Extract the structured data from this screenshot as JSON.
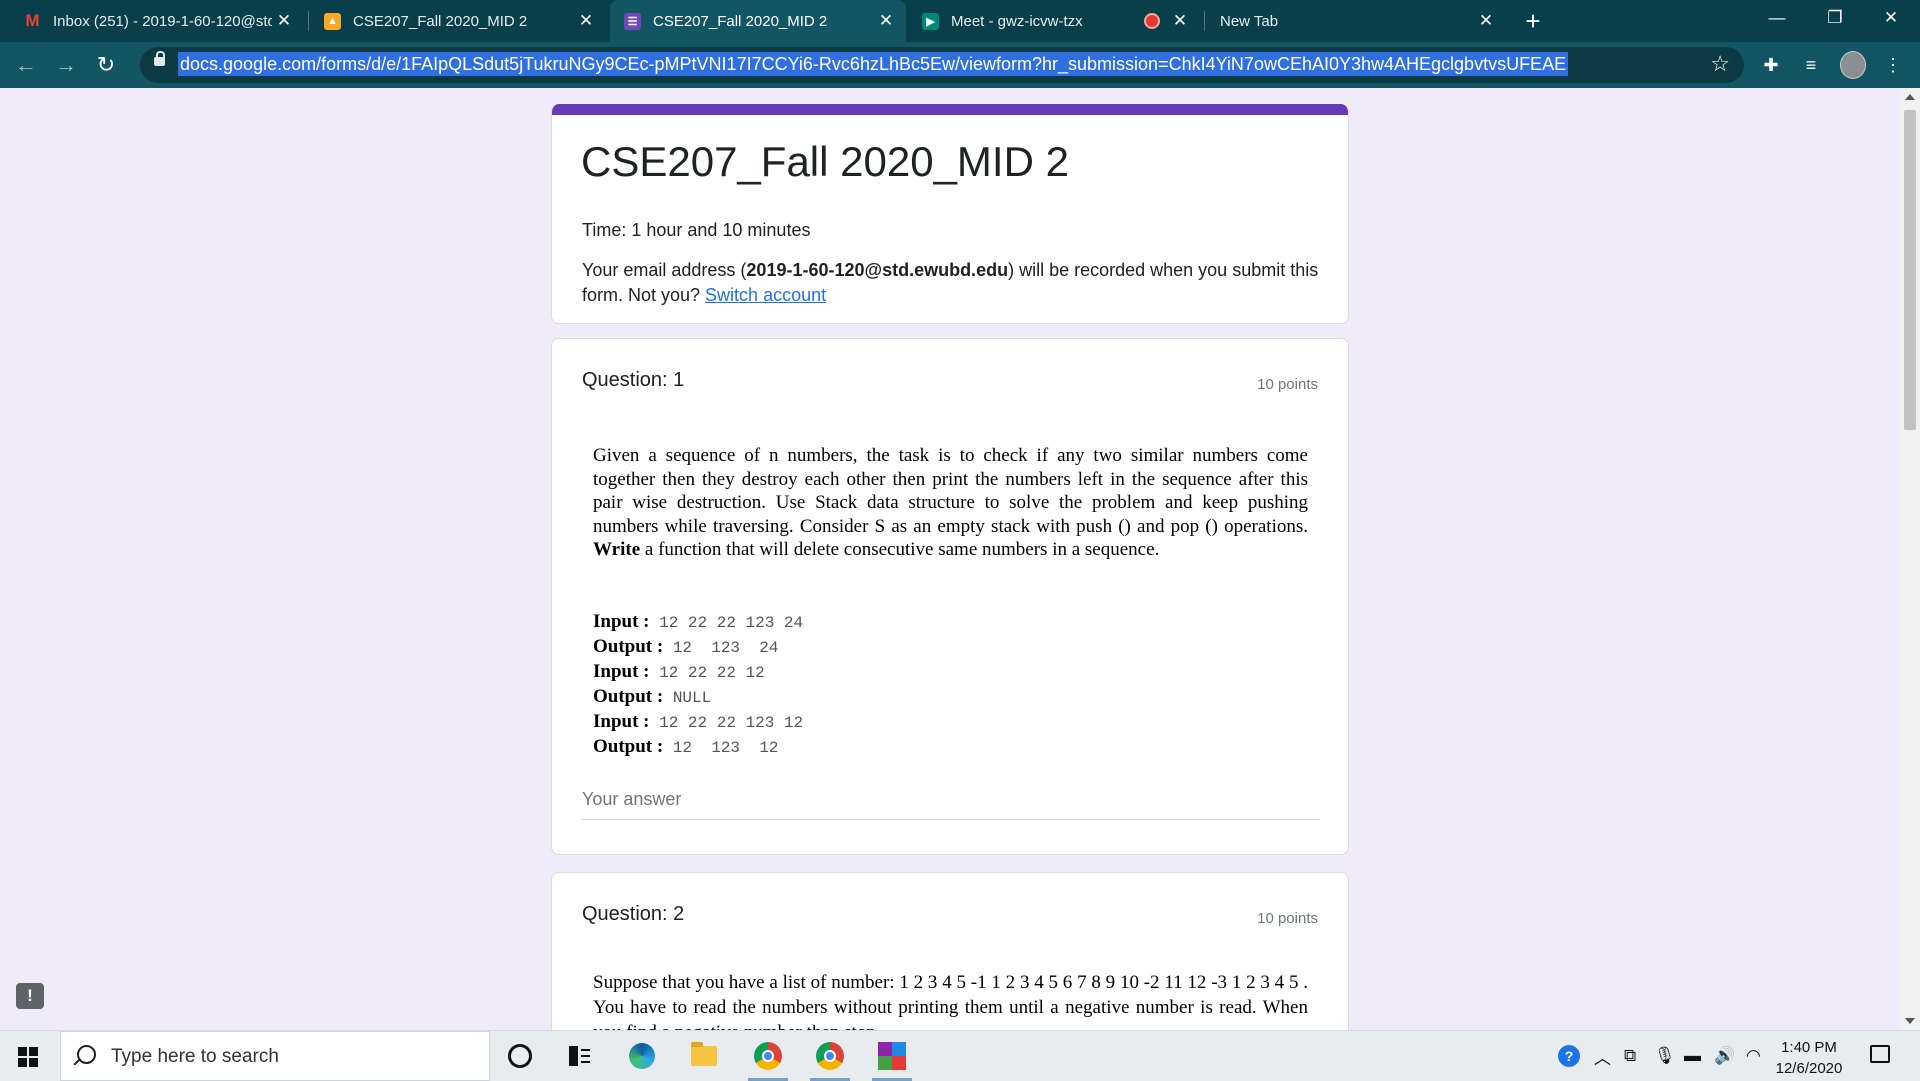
{
  "browser": {
    "tabs": [
      {
        "title": "Inbox (251) - 2019-1-60-120@std",
        "icon": "gmail-icon",
        "close": "✕"
      },
      {
        "title": "CSE207_Fall 2020_MID 2",
        "icon": "classroom-icon",
        "close": "✕"
      },
      {
        "title": "CSE207_Fall 2020_MID 2",
        "icon": "forms-icon",
        "close": "✕",
        "active": true
      },
      {
        "title": "Meet - gwz-icvw-tzx",
        "icon": "meet-icon",
        "close": "✕",
        "recording": true
      },
      {
        "title": "New Tab",
        "close": "✕"
      }
    ],
    "new_tab": "+",
    "window_controls": {
      "minimize": "—",
      "restore": "❐",
      "close": "✕"
    },
    "url": "docs.google.com/forms/d/e/1FAIpQLSdut5jTukruNGy9CEc-pMPtVNI17I7CCYi6-Rvc6hzLhBc5Ew/viewform?hr_submission=ChkI4YiN7owCEhAI0Y3hw4AHEgclgbvtvsUFEAE",
    "nav": {
      "back": "←",
      "forward": "→",
      "reload": "↻"
    },
    "star": "☆"
  },
  "form": {
    "accent": "#673ab7",
    "title": "CSE207_Fall 2020_MID 2",
    "time": "Time: 1 hour and 10 minutes",
    "email_prefix": "Your email address (",
    "email": "2019-1-60-120@std.ewubd.edu",
    "email_suffix": ") will be recorded when you submit this form. Not you? ",
    "switch_account": "Switch account"
  },
  "questions": [
    {
      "title": "Question: 1",
      "points": "10 points",
      "body_1": "Given a sequence of n numbers, the task is to check if any two similar numbers come together then they destroy each other then print the numbers left in the sequence after this pair wise destruction. Use Stack data structure to solve the problem and keep pushing numbers while traversing. Consider S as an empty stack with push () and pop () operations. ",
      "body_bold": "Write",
      "body_2": " a function that will delete consecutive same numbers in a sequence.",
      "io": [
        {
          "label": "Input :",
          "value": " 12 22 22 123 24"
        },
        {
          "label": "Output :",
          "value": " 12  123  24"
        },
        {
          "label": "Input :",
          "value": " 12 22 22 12"
        },
        {
          "label": "Output :",
          "value": " NULL"
        },
        {
          "label": "Input :",
          "value": " 12 22 22 123 12"
        },
        {
          "label": "Output :",
          "value": " 12  123  12"
        }
      ],
      "answer_placeholder": "Your answer"
    },
    {
      "title": "Question: 2",
      "points": "10 points",
      "body": "Suppose that you have a list of number: 1 2 3 4 5 -1 1 2 3 4 5 6 7 8 9 10 -2 11 12 -3 1 2 3 4 5 . You have to read the numbers without printing them until a negative number is read. When you find a negative number then stop"
    }
  ],
  "taskbar": {
    "search_placeholder": "Type here to search",
    "time": "1:40 PM",
    "date": "12/6/2020"
  }
}
